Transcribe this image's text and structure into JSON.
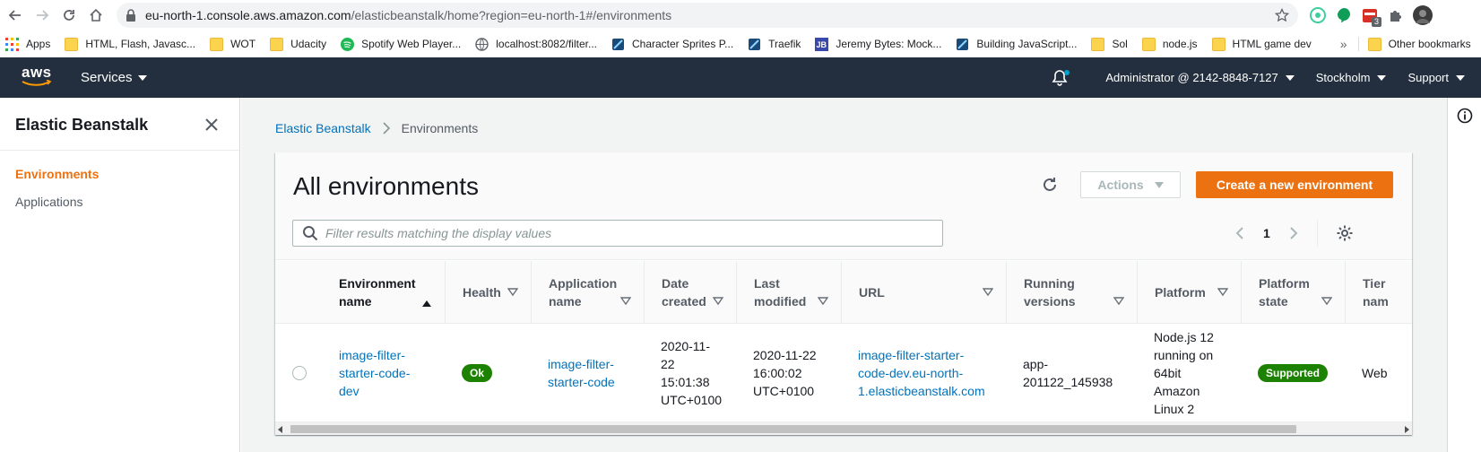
{
  "browser": {
    "url_host": "eu-north-1.console.aws.amazon.com",
    "url_path": "/elasticbeanstalk/home?region=eu-north-1#/environments",
    "extension_badge": "3"
  },
  "bookmarks": [
    {
      "label": "Apps",
      "icon": "apps-grid-icon"
    },
    {
      "label": "HTML, Flash, Javasc...",
      "icon": "folder-icon"
    },
    {
      "label": "WOT",
      "icon": "folder-icon"
    },
    {
      "label": "Udacity",
      "icon": "folder-icon"
    },
    {
      "label": "Spotify Web Player...",
      "icon": "spotify-icon"
    },
    {
      "label": "localhost:8082/filter...",
      "icon": "globe-icon"
    },
    {
      "label": "Character Sprites P...",
      "icon": "site-icon"
    },
    {
      "label": "Traefik",
      "icon": "site-icon"
    },
    {
      "label": "Jeremy Bytes: Mock...",
      "icon": "jb-icon"
    },
    {
      "label": "Building JavaScript...",
      "icon": "site-icon"
    },
    {
      "label": "Sol",
      "icon": "folder-icon"
    },
    {
      "label": "node.js",
      "icon": "folder-icon"
    },
    {
      "label": "HTML game dev",
      "icon": "folder-icon"
    }
  ],
  "bookmarks_overflow": "»",
  "other_bookmarks": "Other bookmarks",
  "aws_nav": {
    "logo_text": "aws",
    "services": "Services",
    "account": "Administrator @ 2142-8848-7127",
    "region": "Stockholm",
    "support": "Support"
  },
  "sidebar": {
    "title": "Elastic Beanstalk",
    "items": [
      {
        "label": "Environments",
        "active": true
      },
      {
        "label": "Applications",
        "active": false
      }
    ]
  },
  "breadcrumb": {
    "root": "Elastic Beanstalk",
    "current": "Environments"
  },
  "panel": {
    "title": "All environments",
    "actions_label": "Actions",
    "create_label": "Create a new environment",
    "filter_placeholder": "Filter results matching the display values",
    "page_number": "1"
  },
  "table": {
    "columns": [
      {
        "line1": "Environment",
        "line2": "name",
        "sort": "ascending"
      },
      {
        "line1": "Health",
        "line2": "",
        "sort": "filter"
      },
      {
        "line1": "Application",
        "line2": "name",
        "sort": "filter"
      },
      {
        "line1": "Date",
        "line2": "created",
        "sort": "filter"
      },
      {
        "line1": "Last",
        "line2": "modified",
        "sort": "filter"
      },
      {
        "line1": "URL",
        "line2": "",
        "sort": "filter"
      },
      {
        "line1": "Running",
        "line2": "versions",
        "sort": "filter"
      },
      {
        "line1": "Platform",
        "line2": "",
        "sort": "filter"
      },
      {
        "line1": "Platform",
        "line2": "state",
        "sort": "filter"
      },
      {
        "line1": "Tier",
        "line2": "nam",
        "sort": ""
      }
    ],
    "rows": [
      {
        "env_name": [
          "image-filter-",
          "starter-code-",
          "dev"
        ],
        "health": "Ok",
        "app_name": [
          "image-filter-",
          "starter-code"
        ],
        "date_created": [
          "2020-11-",
          "22",
          "15:01:38",
          "UTC+0100"
        ],
        "last_modified": [
          "2020-11-22",
          "16:00:02",
          "UTC+0100"
        ],
        "url": [
          "image-filter-starter-",
          "code-dev.eu-north-",
          "1.elasticbeanstalk.com"
        ],
        "running_versions": [
          "app-",
          "201122_145938"
        ],
        "platform": [
          "Node.js 12",
          "running on",
          "64bit",
          "Amazon",
          "Linux 2"
        ],
        "platform_state": "Supported",
        "tier": "Web"
      }
    ]
  },
  "colors": {
    "aws_nav_bg": "#232f3e",
    "accent_orange": "#ec7211",
    "link_blue": "#0073bb",
    "status_green": "#1d8102"
  }
}
